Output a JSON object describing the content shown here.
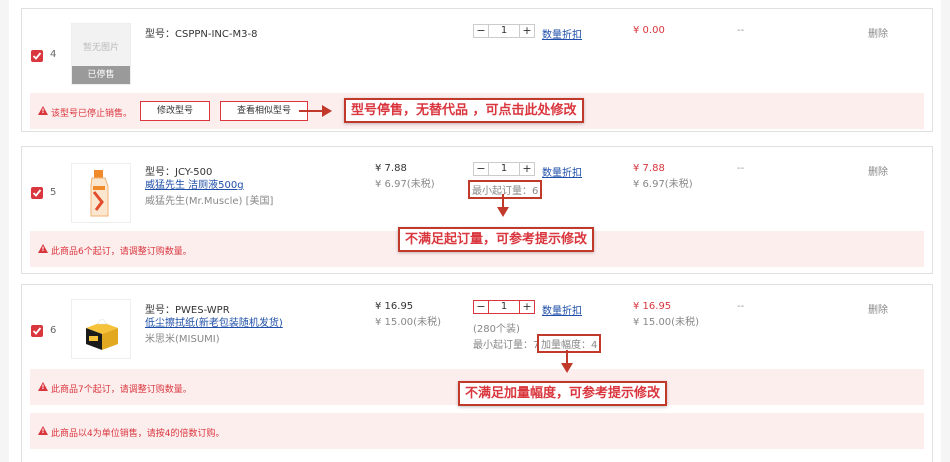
{
  "items": [
    {
      "index": "4",
      "no_image": "暂无图片",
      "stopped_label": "已停售",
      "model": "型号：CSPPN-INC-M3-8",
      "qty": "1",
      "discount_link": "数量折扣",
      "subtotal": "¥ 0.00",
      "dash": "--",
      "delete": "删除",
      "warning": "该型号已停止销售。",
      "btn_change": "修改型号",
      "btn_similar": "查看相似型号",
      "callout": "型号停售，无替代品 ，可点击此处修改"
    },
    {
      "index": "5",
      "model": "型号：JCY-500",
      "name": "威猛先生 洁厕液500g",
      "brand": "威猛先生(Mr.Muscle) [美国]",
      "price": "¥ 7.88",
      "price_ex_tax": "¥ 6.97(未税)",
      "qty": "1",
      "discount_link": "数量折扣",
      "min_order": "最小起订量：6",
      "subtotal": "¥ 7.88",
      "subtotal_ex_tax": "¥ 6.97(未税)",
      "dash": "--",
      "delete": "删除",
      "warning": "此商品6个起订，请调整订购数量。",
      "callout": "不满足起订量，可参考提示修改"
    },
    {
      "index": "6",
      "model": "型号：PWES-WPR",
      "name": "低尘擦拭纸(新老包装随机发货)",
      "brand": "米思米(MISUMI)",
      "price": "¥ 16.95",
      "price_ex_tax": "¥ 15.00(未税)",
      "qty": "1",
      "discount_link": "数量折扣",
      "pack": "(280个装)",
      "min_order": "最小起订量：7",
      "increment": "加量幅度：4",
      "subtotal": "¥ 16.95",
      "subtotal_ex_tax": "¥ 15.00(未税)",
      "dash": "--",
      "delete": "删除",
      "warning": "此商品7个起订，请调整订购数量。",
      "warning2": "此商品以4为单位销售，请按4的倍数订购。",
      "callout": "不满足加量幅度，可参考提示修改"
    }
  ],
  "colors": {
    "accent": "#d9363e",
    "warn_bg": "#fdeeee",
    "link": "#1f4fa8"
  }
}
